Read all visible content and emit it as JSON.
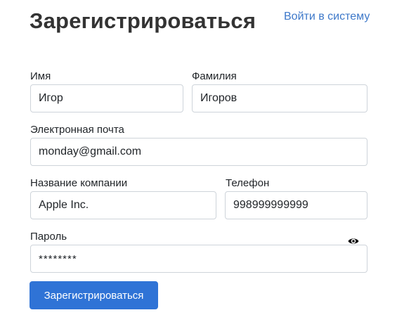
{
  "header": {
    "title": "Зарегистрироваться",
    "login_link": "Войти в систему"
  },
  "form": {
    "first_name": {
      "label": "Имя",
      "value": "Игор"
    },
    "last_name": {
      "label": "Фамилия",
      "value": "Игоров"
    },
    "email": {
      "label": "Электронная почта",
      "value": "monday@gmail.com"
    },
    "company": {
      "label": "Название компании",
      "value": "Apple Inc."
    },
    "phone": {
      "label": "Телефон",
      "value": "998999999999"
    },
    "password": {
      "label": "Пароль",
      "value": "********",
      "toggle_icon": "eye-icon"
    },
    "submit_label": "Зарегистрироваться"
  },
  "colors": {
    "accent": "#2f73d6",
    "link": "#3d78c9",
    "title": "#333333",
    "border": "#ced4da"
  }
}
